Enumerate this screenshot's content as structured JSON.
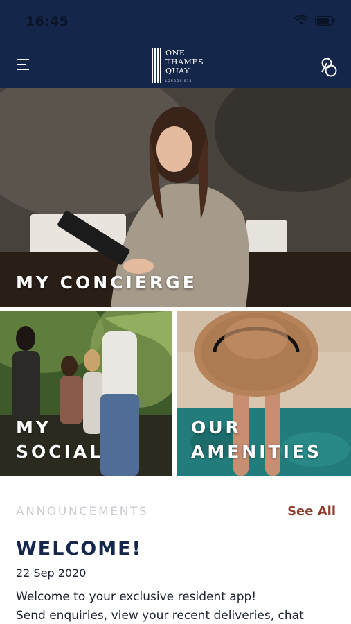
{
  "status_bar": {
    "time": "16:45"
  },
  "header": {
    "logo_lines": [
      "ONE",
      "THAMES",
      "QUAY"
    ],
    "logo_sub": "LONDON E14",
    "background": "#14264a"
  },
  "tiles": {
    "concierge": {
      "label": "MY CONCIERGE"
    },
    "social": {
      "label_line1": "MY",
      "label_line2": "SOCIAL"
    },
    "amenities": {
      "label_line1": "OUR",
      "label_line2": "AMENITIES"
    }
  },
  "announcements": {
    "heading": "ANNOUNCEMENTS",
    "see_all": "See All",
    "title": "WELCOME!",
    "date": "22 Sep 2020",
    "body_line1": "Welcome to your exclusive resident app!",
    "body_line2": "Send enquiries, view your recent deliveries, chat"
  },
  "colors": {
    "navy": "#14264a",
    "accent": "#8b3c2a",
    "muted": "#c9ccd2"
  }
}
